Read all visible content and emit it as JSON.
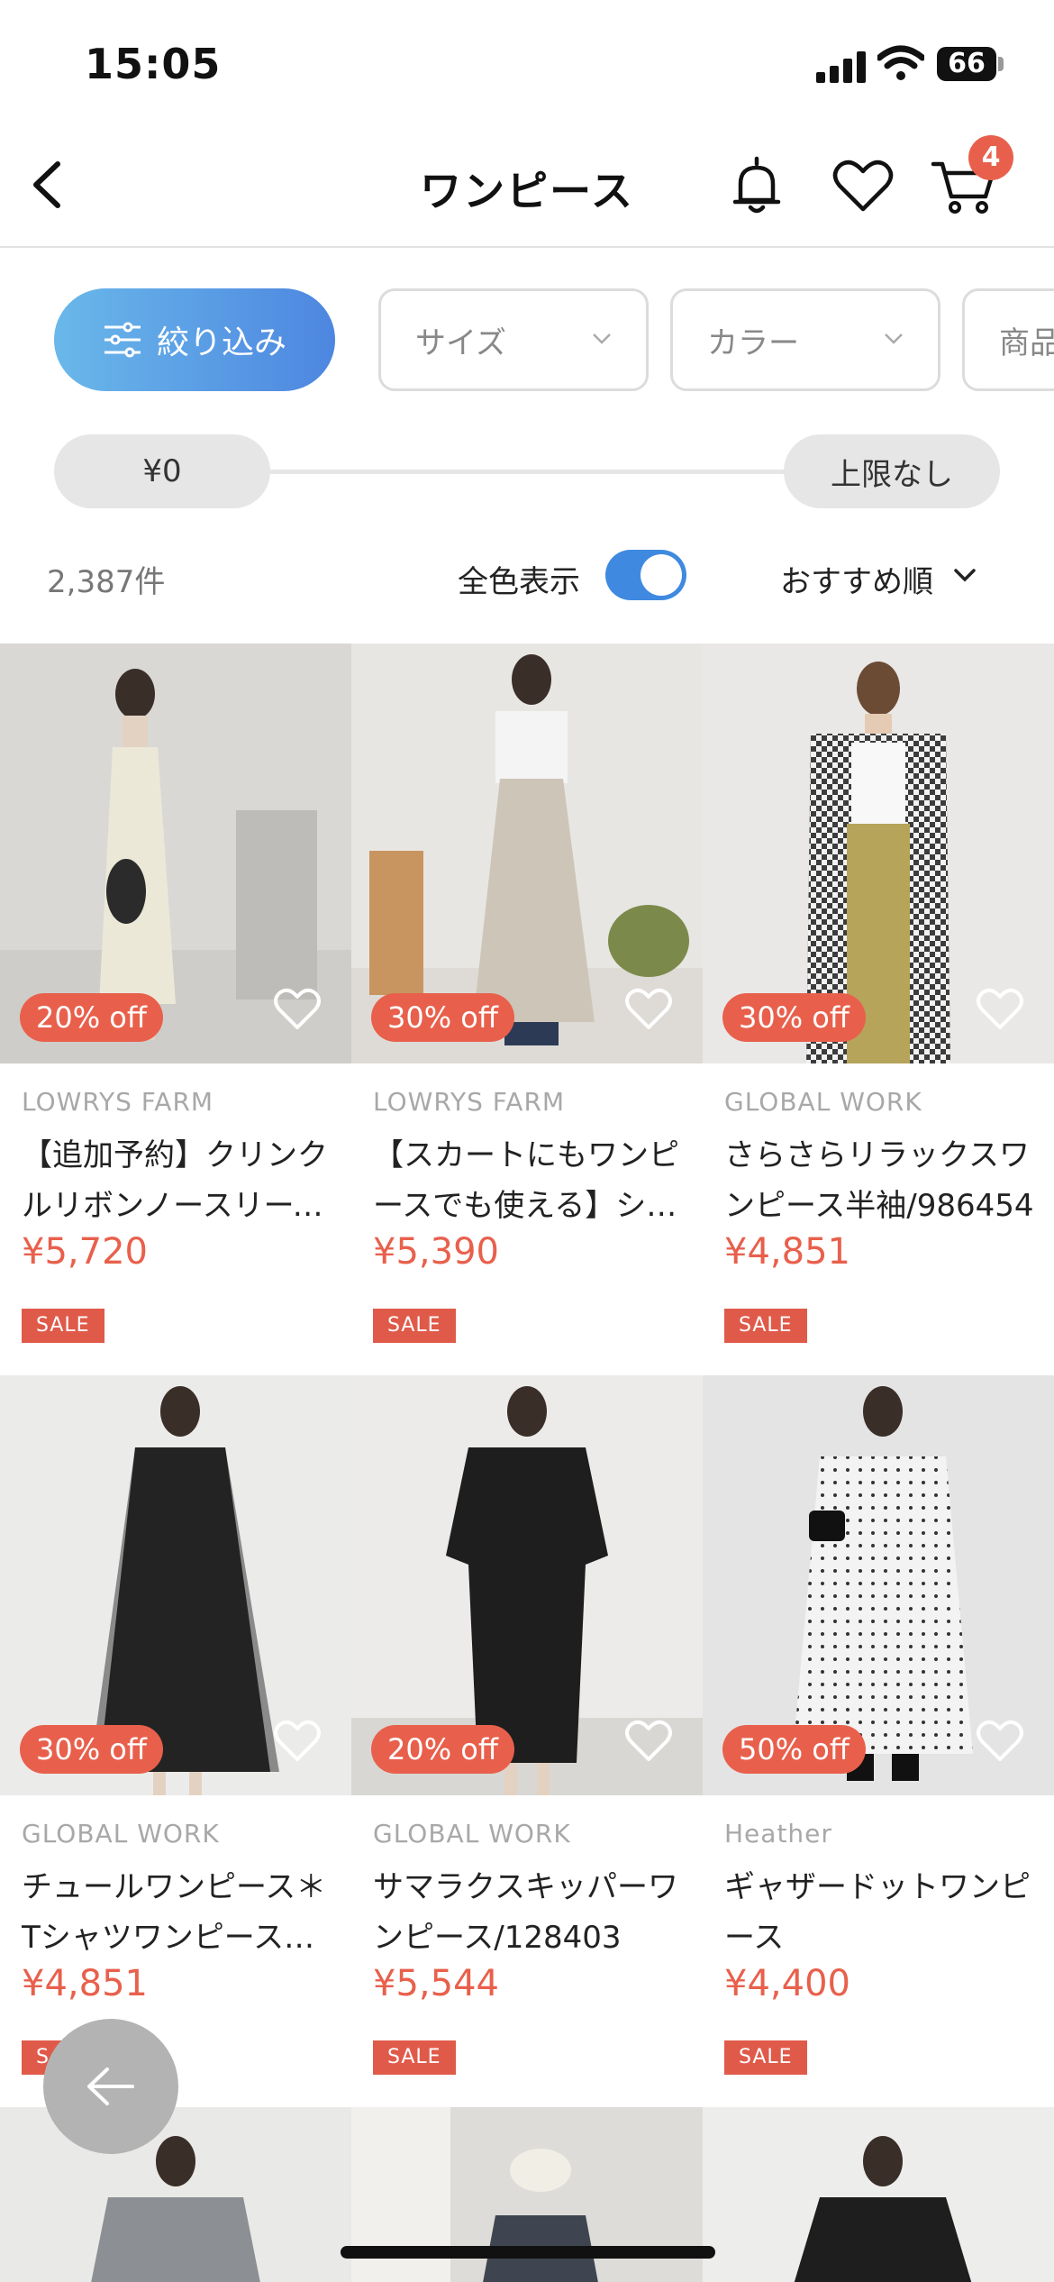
{
  "status_bar": {
    "time": "15:05",
    "battery": "66"
  },
  "nav": {
    "title": "ワンピース",
    "cart_count": "4"
  },
  "filters": {
    "refine_label": "絞り込み",
    "size_label": "サイズ",
    "color_label": "カラー",
    "product_label": "商品"
  },
  "price": {
    "min": "¥0",
    "max": "上限なし"
  },
  "results": {
    "count": "2,387件",
    "all_colors_label": "全色表示",
    "all_colors_on": true,
    "sort_label": "おすすめ順"
  },
  "products": [
    {
      "discount": "20% off",
      "brand": "LOWRYS FARM",
      "name": "【追加予約】クリンクルリボンノースリーブワンピース",
      "price": "¥5,720",
      "badge": "SALE",
      "image": "cream sleeveless tiered dress"
    },
    {
      "discount": "30% off",
      "brand": "LOWRYS FARM",
      "name": "【スカートにもワンピースでも使える】シャーリングワンピース",
      "price": "¥5,390",
      "badge": "SALE",
      "image": "beige shirred dress over white tee"
    },
    {
      "discount": "30% off",
      "brand": "GLOBAL WORK",
      "name": "さらさらリラックスワンピース半袖/986454",
      "price": "¥4,851",
      "badge": "SALE",
      "image": "gingham shirt dress with khaki pants"
    },
    {
      "discount": "30% off",
      "brand": "GLOBAL WORK",
      "name": "チュールワンピース＊TシャツワンピースSET",
      "price": "¥4,851",
      "badge": "SALE",
      "image": "black tulle dress"
    },
    {
      "discount": "20% off",
      "brand": "GLOBAL WORK",
      "name": "サマラクスキッパーワンピース/128403",
      "price": "¥5,544",
      "badge": "SALE",
      "image": "black skipper dress"
    },
    {
      "discount": "50% off",
      "brand": "Heather",
      "name": "ギャザードットワンピース",
      "price": "¥4,400",
      "badge": "SALE",
      "image": "white polka dot off-shoulder dress"
    }
  ],
  "colors": {
    "accent": "#e8604c",
    "toggle": "#3f8ae0",
    "filter_gradient_start": "#6ab8ea",
    "filter_gradient_end": "#4d86e0"
  }
}
